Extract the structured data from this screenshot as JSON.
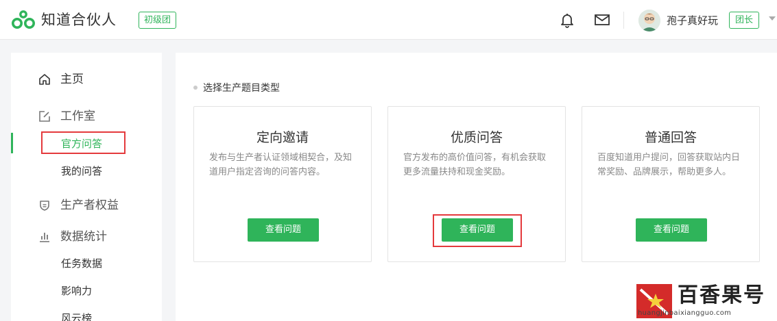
{
  "header": {
    "logo_text": "知道合伙人",
    "level_badge": "初级团",
    "username": "孢子真好玩",
    "role_badge": "团长",
    "icons": {
      "logo": "zhidao-logo-icon",
      "notifications": "bell-icon",
      "messages": "mail-icon",
      "avatar": "user-avatar",
      "role_dropdown": "caret-down-icon"
    }
  },
  "sidebar": {
    "home": {
      "label": "主页",
      "icon": "home-icon"
    },
    "studio": {
      "label": "工作室",
      "icon": "edit-icon"
    },
    "studio_items": [
      {
        "label": "官方问答",
        "active": true
      },
      {
        "label": "我的问答",
        "active": false
      }
    ],
    "rights": {
      "label": "生产者权益",
      "icon": "shield-icon"
    },
    "stats": {
      "label": "数据统计",
      "icon": "bar-chart-icon"
    },
    "stats_items": [
      {
        "label": "任务数据"
      },
      {
        "label": "影响力"
      },
      {
        "label": "风云榜"
      }
    ]
  },
  "main": {
    "section_title": "选择生产题目类型",
    "cards": [
      {
        "title": "定向邀请",
        "desc": "发布与生产者认证领域相契合，及知道用户指定咨询的问答内容。",
        "button": "查看问题"
      },
      {
        "title": "优质问答",
        "desc": "官方发布的高价值问答，有机会获取更多流量扶持和现金奖励。",
        "button": "查看问题"
      },
      {
        "title": "普通回答",
        "desc": "百度知道用户提问，回答获取站内日常奖励、品牌展示，帮助更多人。",
        "button": "查看问题"
      }
    ]
  },
  "watermark": {
    "text": "百香果号",
    "url": "huangjinbaixiangguo.com"
  },
  "colors": {
    "brand_green": "#2fb45a",
    "highlight_red": "#e4393c",
    "watermark_red": "#d42b2a"
  }
}
